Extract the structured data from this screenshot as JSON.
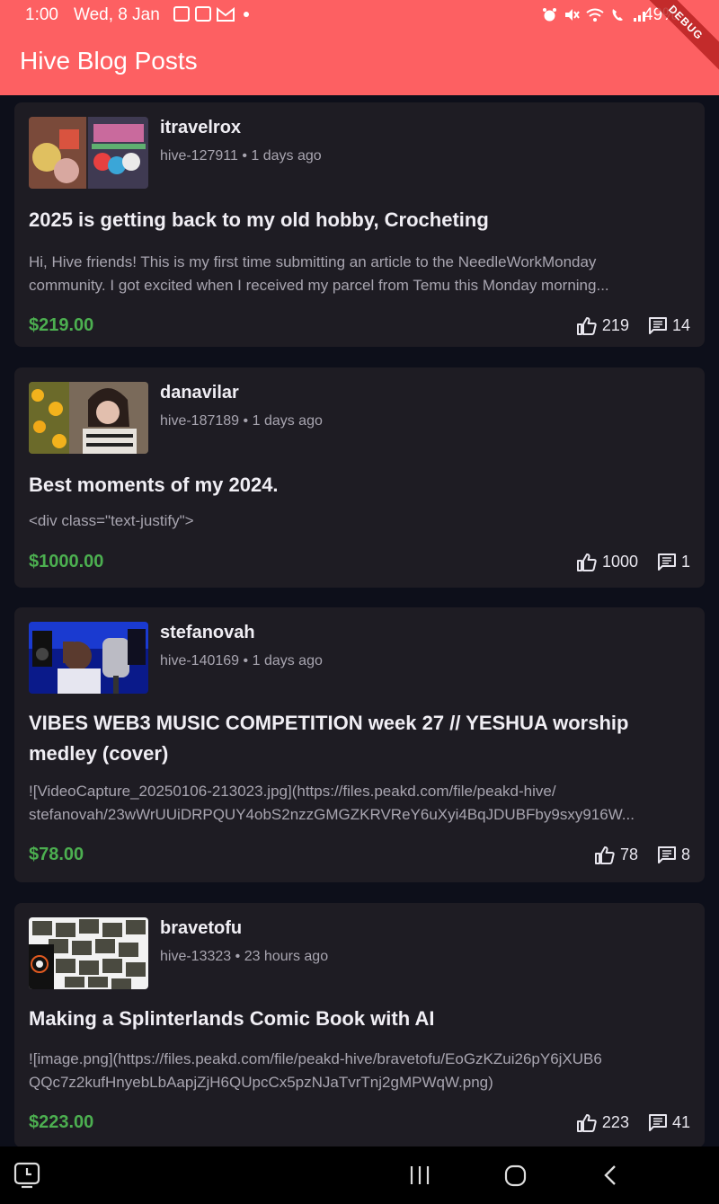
{
  "status_bar": {
    "time": "1:00",
    "date": "Wed, 8 Jan",
    "battery": "49%"
  },
  "app_bar": {
    "title": "Hive Blog Posts",
    "debug_label": "DEBUG",
    "color": "#fd6062"
  },
  "posts": [
    {
      "author": "itravelrox",
      "community": "hive-127911",
      "separator": "•",
      "age": "1 days ago",
      "title": "2025 is getting back to my old hobby, Crocheting",
      "body_lines": [
        "Hi, Hive friends! This is my first time submitting an article to the NeedleWorkMonday",
        "community. I got excited when I received my parcel from Temu this Monday morning..."
      ],
      "payout": "$219.00",
      "votes": "219",
      "comments": "14",
      "thumb_icon": "crochet-yarn-photo"
    },
    {
      "author": "danavilar",
      "community": "hive-187189",
      "separator": "•",
      "age": "1 days ago",
      "title": "Best moments of my 2024.",
      "body_lines": [
        "<div class=\"text-justify\">"
      ],
      "payout": "$1000.00",
      "votes": "1000",
      "comments": "1",
      "thumb_icon": "portrait-with-flowers-photo"
    },
    {
      "author": "stefanovah",
      "community": "hive-140169",
      "separator": "•",
      "age": "1 days ago",
      "title": "VIBES WEB3 MUSIC COMPETITION week 27 // YESHUA worship medley (cover)",
      "body_lines": [
        "![VideoCapture_20250106-213023.jpg](https://files.peakd.com/file/peakd-hive/",
        "stefanovah/23wWrUUiDRPQUY4obS2nzzGMGZKRVReY6uXyi4BqJDUBFby9sxy916W..."
      ],
      "payout": "$78.00",
      "votes": "78",
      "comments": "8",
      "thumb_icon": "music-studio-photo"
    },
    {
      "author": "bravetofu",
      "community": "hive-13323",
      "separator": "•",
      "age": "23 hours ago",
      "title": "Making a Splinterlands Comic Book with AI",
      "body_lines": [
        "![image.png](https://files.peakd.com/file/peakd-hive/bravetofu/EoGzKZui26pY6jXUB6",
        "QQc7z2kufHnyebLbAapjZjH6QUpcCx5pzNJaTvrTnj2gMPWqW.png)"
      ],
      "payout": "$223.00",
      "votes": "223",
      "comments": "41",
      "thumb_icon": "comic-book-pages-photo"
    }
  ],
  "colors": {
    "background": "#0d0f1a",
    "card": "#1e1c23",
    "payout": "#4caf50",
    "secondary_text": "#a8a5b0"
  },
  "nav_icons": [
    "recents-icon",
    "home-icon",
    "back-icon",
    "screen-time-icon"
  ]
}
